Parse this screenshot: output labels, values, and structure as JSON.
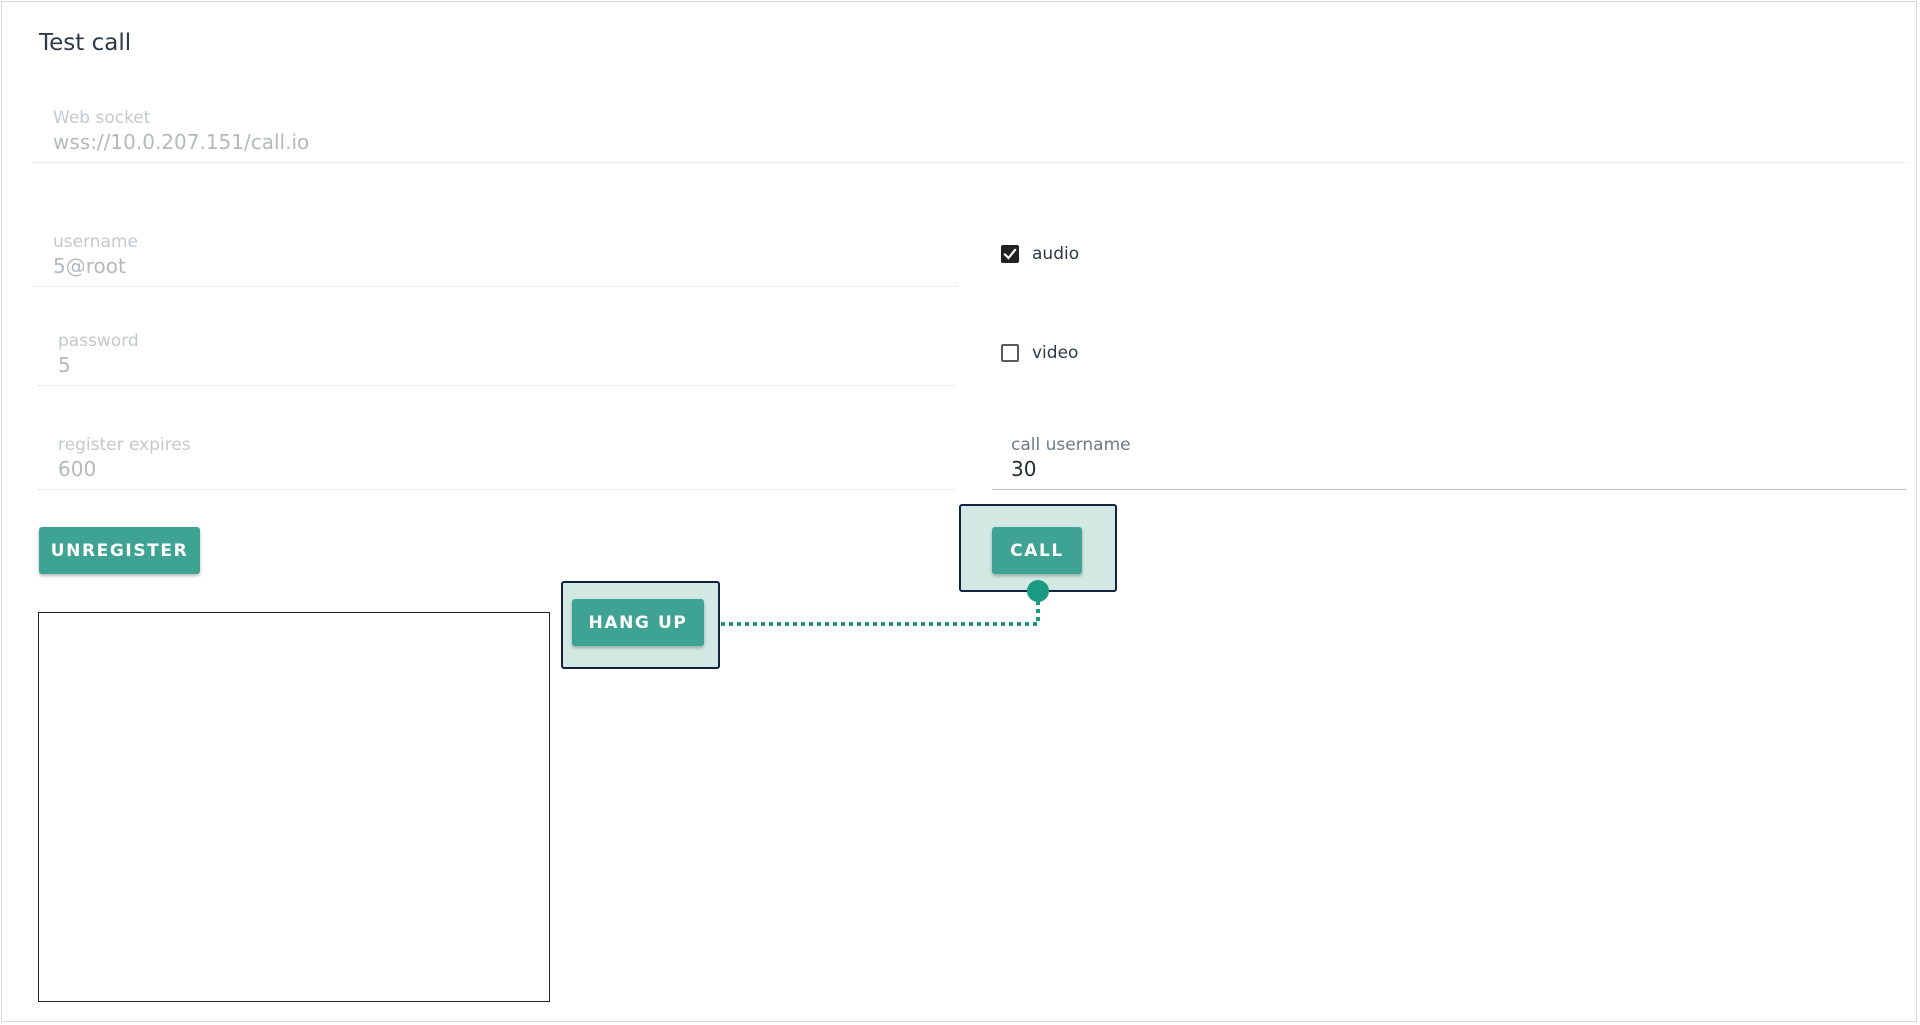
{
  "page": {
    "title": "Test call"
  },
  "form": {
    "websocket": {
      "label": "Web socket",
      "value": "wss://10.0.207.151/call.io"
    },
    "username": {
      "label": "username",
      "value": "5@root"
    },
    "password": {
      "label": "password",
      "value": "5"
    },
    "register_expires": {
      "label": "register expires",
      "value": "600"
    },
    "call_username": {
      "label": "call username",
      "value": "30"
    },
    "audio": {
      "label": "audio",
      "checked": true
    },
    "video": {
      "label": "video",
      "checked": false
    }
  },
  "buttons": {
    "unregister": "UNREGISTER",
    "call": "CALL",
    "hang_up": "HANG UP"
  },
  "colors": {
    "button": "#3ea393",
    "highlight_fill": "#d2e9e3",
    "highlight_border": "#13233f",
    "connector": "#1a9a80"
  }
}
